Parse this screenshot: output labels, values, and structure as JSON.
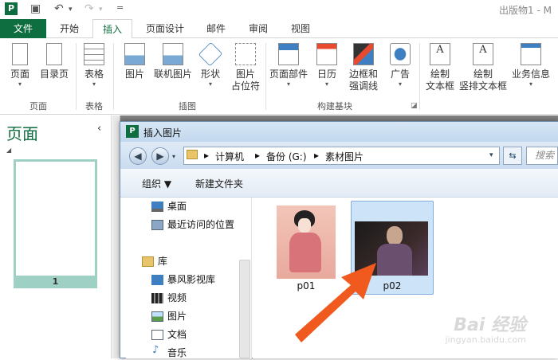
{
  "app_title": "出版物1 - M",
  "quick_access": {
    "undo_label": "↶",
    "redo_label": "↷",
    "more_label": "="
  },
  "tabs": [
    {
      "label": "文件"
    },
    {
      "label": "开始"
    },
    {
      "label": "插入"
    },
    {
      "label": "页面设计"
    },
    {
      "label": "邮件"
    },
    {
      "label": "审阅"
    },
    {
      "label": "视图"
    }
  ],
  "ribbon": {
    "buttons": [
      {
        "label": "页面",
        "icon": "page-icon"
      },
      {
        "label": "目录页",
        "icon": "catalog-page-icon"
      },
      {
        "label": "表格",
        "icon": "table-icon"
      },
      {
        "label": "图片",
        "icon": "picture-icon"
      },
      {
        "label": "联机图片",
        "icon": "online-picture-icon"
      },
      {
        "label": "形状",
        "icon": "shapes-icon"
      },
      {
        "label": "图片",
        "label2": "占位符",
        "icon": "picture-placeholder-icon"
      },
      {
        "label": "页面部件",
        "icon": "page-parts-icon"
      },
      {
        "label": "日历",
        "icon": "calendar-icon"
      },
      {
        "label": "边框和",
        "label2": "强调线",
        "icon": "borders-icon"
      },
      {
        "label": "广告",
        "icon": "advertisement-icon"
      },
      {
        "label": "绘制",
        "label2": "文本框",
        "icon": "draw-textbox-icon"
      },
      {
        "label": "绘制",
        "label2": "竖排文本框",
        "icon": "vertical-textbox-icon"
      },
      {
        "label": "业务信息",
        "icon": "business-info-icon"
      }
    ],
    "groups": {
      "pages": "页面",
      "tables": "表格",
      "illustrations": "插图",
      "building_blocks": "构建基块"
    }
  },
  "left_pane": {
    "title": "页面",
    "collapse": "‹",
    "page_number": "1"
  },
  "dialog": {
    "title": "插入图片",
    "breadcrumb": [
      "计算机",
      "备份 (G:)",
      "素材图片"
    ],
    "search_placeholder": "搜索 素材图片",
    "organize": "组织 ▼",
    "new_folder": "新建文件夹",
    "nav_items": [
      {
        "label": "桌面",
        "icon": "desktop-icon"
      },
      {
        "label": "最近访问的位置",
        "icon": "recent-places-icon"
      },
      {
        "label": "库",
        "icon": "library-icon"
      },
      {
        "label": "暴风影视库",
        "icon": "video-library-icon"
      },
      {
        "label": "视频",
        "icon": "video-icon"
      },
      {
        "label": "图片",
        "icon": "pictures-icon"
      },
      {
        "label": "文档",
        "icon": "documents-icon"
      },
      {
        "label": "音乐",
        "icon": "music-icon"
      }
    ],
    "files": [
      {
        "name": "p01",
        "selected": false
      },
      {
        "name": "p02",
        "selected": true
      }
    ]
  },
  "watermark": {
    "text": "Bai 经验",
    "url": "jingyan.baidu.com"
  },
  "colors": {
    "accent": "#0f6e3f",
    "arrow": "#f05a1e",
    "selection": "#cde3f7"
  }
}
